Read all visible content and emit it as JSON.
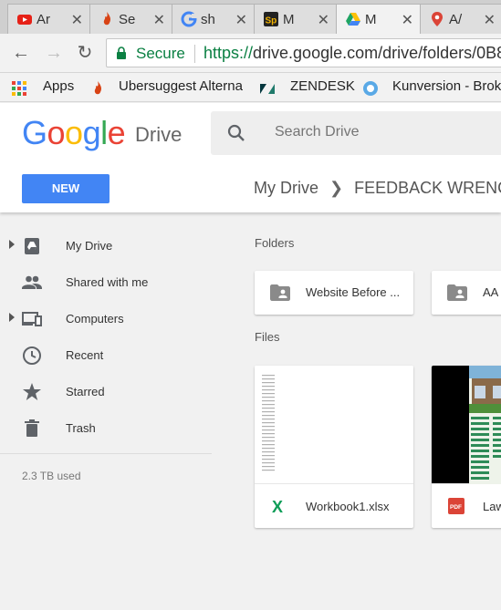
{
  "browser": {
    "tabs": [
      {
        "title": "Ar",
        "icon": "youtube-icon",
        "color": "#e62117"
      },
      {
        "title": "Se",
        "icon": "flame-icon",
        "color": "#d84315"
      },
      {
        "title": "sh",
        "icon": "google-g-icon",
        "color": "#4285f4"
      },
      {
        "title": "M",
        "icon": "sp-icon",
        "color": "#222222"
      },
      {
        "title": "M",
        "icon": "drive-icon",
        "color": "#1fa463"
      },
      {
        "title": "A/",
        "icon": "maps-pin-icon",
        "color": "#db4437"
      }
    ],
    "tab_close": "✕",
    "secure_label": "Secure",
    "url_scheme": "https://",
    "url_host": "drive.google.com",
    "url_path": "/drive/folders/0B8"
  },
  "bookmarks": [
    {
      "label": "Apps",
      "icon": "apps-grid-icon"
    },
    {
      "label": "Ubersuggest Alterna",
      "icon": "flame-icon"
    },
    {
      "label": "ZENDESK",
      "icon": "zendesk-icon"
    },
    {
      "label": "Kunversion - Brok",
      "icon": "kunversion-icon"
    }
  ],
  "header": {
    "logo_google": [
      "G",
      "o",
      "o",
      "g",
      "l",
      "e"
    ],
    "logo_drive": "Drive",
    "search_placeholder": "Search Drive",
    "new_button": "NEW",
    "breadcrumb": [
      "My Drive",
      "FEEDBACK WRENCH"
    ]
  },
  "sidebar": {
    "items": [
      {
        "label": "My Drive",
        "icon": "my-drive-icon",
        "expandable": true
      },
      {
        "label": "Shared with me",
        "icon": "shared-people-icon",
        "expandable": false
      },
      {
        "label": "Computers",
        "icon": "computers-icon",
        "expandable": true
      },
      {
        "label": "Recent",
        "icon": "clock-icon",
        "expandable": false
      },
      {
        "label": "Starred",
        "icon": "star-icon",
        "expandable": false
      },
      {
        "label": "Trash",
        "icon": "trash-icon",
        "expandable": false
      }
    ],
    "storage": "2.3 TB used"
  },
  "main": {
    "folders_title": "Folders",
    "folders": [
      {
        "name": "Website Before ..."
      },
      {
        "name": "AA"
      }
    ],
    "files_title": "Files",
    "files": [
      {
        "name": "Workbook1.xlsx",
        "icon": "excel-icon",
        "icon_color": "#0f9d58"
      },
      {
        "name": "Law",
        "icon": "pdf-icon",
        "icon_color": "#db4437"
      }
    ]
  }
}
